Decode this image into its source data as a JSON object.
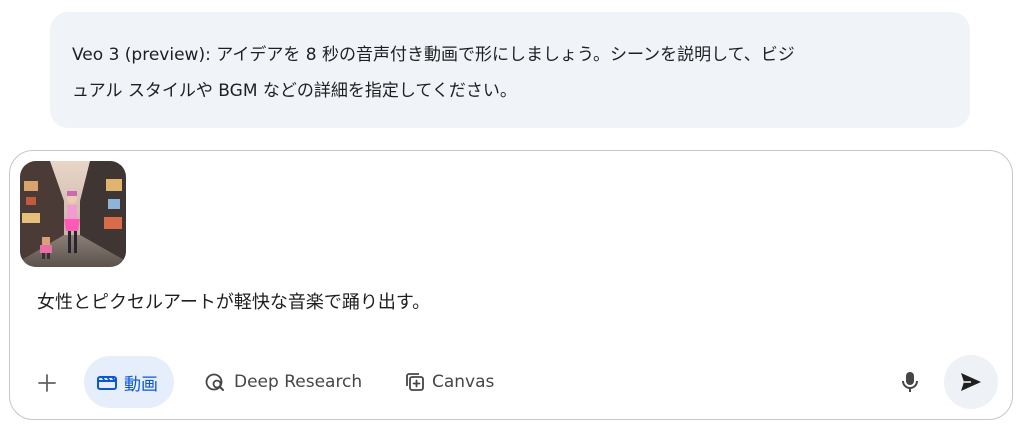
{
  "banner": {
    "line1": "Veo 3 (preview): アイデアを 8 秒の音声付き動画で形にしましょう。シーンを説明して、ビジ",
    "line2": "ュアル スタイルや BGM などの詳細を指定してください。"
  },
  "composer": {
    "attachment_icon": "image-thumbnail",
    "prompt_text": "女性とピクセルアートが軽快な音楽で踊り出す。",
    "toolbar": {
      "add_icon": "plus-icon",
      "video_label": "動画",
      "video_icon": "clapperboard-icon",
      "deep_research_label": "Deep Research",
      "deep_research_icon": "research-search-icon",
      "canvas_label": "Canvas",
      "canvas_icon": "canvas-add-icon",
      "mic_icon": "microphone-icon",
      "send_icon": "send-icon"
    }
  },
  "colors": {
    "banner_bg": "#f0f4f9",
    "chip_bg": "#e7eefb",
    "accent": "#0b57d0",
    "text": "#1f1f1f",
    "muted": "#444746"
  }
}
